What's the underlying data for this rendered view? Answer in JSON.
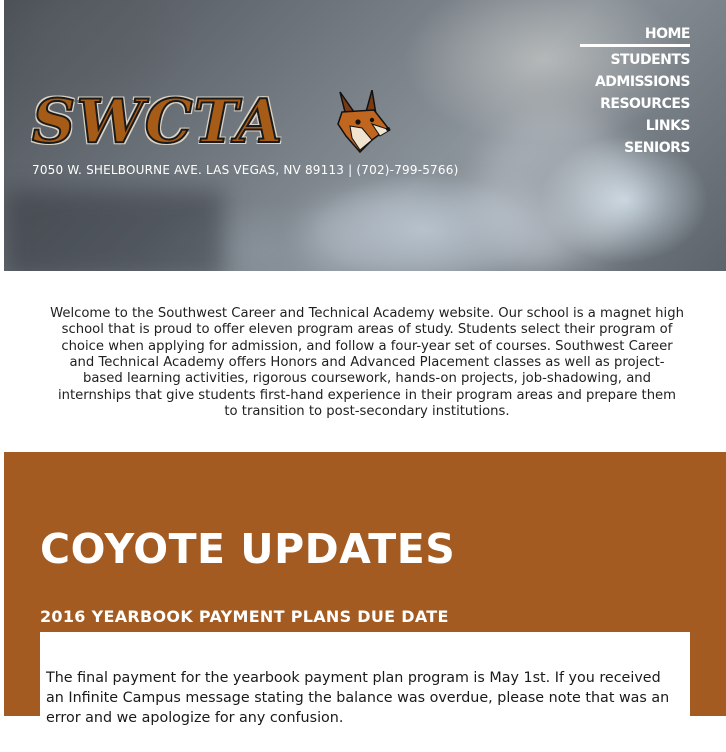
{
  "logo": {
    "text": "SWCTA",
    "mascot": "coyote-head-icon"
  },
  "address": "7050 W. SHELBOURNE AVE. LAS VEGAS, NV 89113 | (702)-799-5766)",
  "nav": [
    {
      "label": "HOME"
    },
    {
      "label": "STUDENTS"
    },
    {
      "label": "ADMISSIONS"
    },
    {
      "label": "RESOURCES"
    },
    {
      "label": "LINKS"
    },
    {
      "label": "SENIORS"
    }
  ],
  "intro": "Welcome to the Southwest Career and Technical Academy website. Our school is a magnet high school that is proud to offer eleven program areas of study. Students select their program of choice when applying for admission, and follow a four-year set of courses. Southwest Career and Technical Academy offers Honors and Advanced Placement classes as well as project-based learning activities, rigorous coursework, hands-on projects, job-shadowing, and internships that give students first-hand experience in their program areas and prepare them to transition to post-secondary institutions.",
  "updates": {
    "title": "COYOTE UPDATES",
    "post": {
      "title": "2016 YEARBOOK PAYMENT PLANS DUE DATE",
      "body": "The final payment for the yearbook payment plan program is May 1st. If you received an Infinite Campus message stating the balance was overdue, please note that was an error and we apologize for any confusion."
    }
  },
  "colors": {
    "brand_brown": "#a35b22",
    "logo_orange": "#a65b17",
    "text": "#1f1f1f"
  }
}
